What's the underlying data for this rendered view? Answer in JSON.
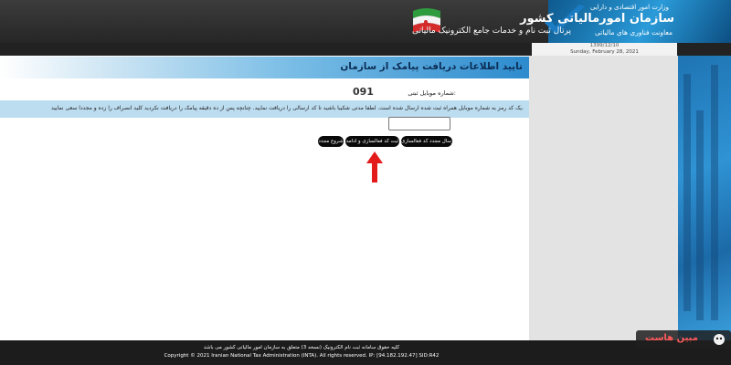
{
  "header": {
    "ministry": "وزارت امور اقتصادی و دارایی",
    "org_name": "سازمان امورمالیاتی کشور",
    "deputy": "معاونت فناوری های مالیاتی",
    "portal_title": "پرتال ثبت نام و خدمات جامع الکترونیک مالیاتی"
  },
  "date": {
    "persian": "1399/12/10",
    "gregorian": "Sunday, February 28, 2021"
  },
  "main": {
    "title": "تایید اطلاعات دریافت پیامک از سازمان",
    "mobile_label": "شماره موبایل ثبتی:",
    "mobile_value": "091",
    "info_text": "یک کد رمز به شماره موبایل همراه ثبت شده ارسال شده است. لطفا مدتی شکیبا باشید تا کد ارسالی را دریافت نمایید. چنانچه پس از ده دقیقه پیامک را دریافت نکردید کلید انصراف را زده و مجددا سعی نمایید.",
    "code_input_value": "",
    "buttons": {
      "resend": "ارسال مجدد کد فعالسازی",
      "submit": "ثبت کد فعالسازی و ادامه",
      "restart": "شروع مجدد"
    }
  },
  "footer": {
    "line1": "کلیه حقوق سامانه ثبت نام الکترونیک (نسخه 3) متعلق به سازمان امور مالیاتی کشور می باشد",
    "line2": "Copyright © 2021 Iranian National Tax Administration (INTA). All rights reserved.   IP: [94.182.192.47]  SID:R42"
  },
  "watermark": {
    "text": "مبین هاست"
  },
  "colors": {
    "accent_blue": "#2b86c4",
    "title_color": "#0b2d55",
    "button_bg": "#0a0a0a",
    "arrow_red": "#e31b1b"
  }
}
